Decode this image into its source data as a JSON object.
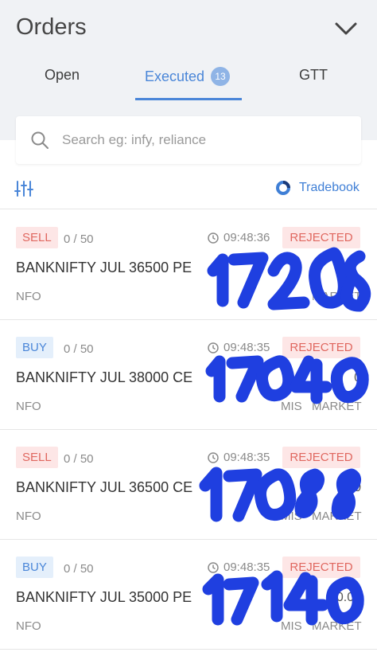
{
  "header": {
    "title": "Orders"
  },
  "tabs": {
    "open": "Open",
    "executed": "Executed",
    "executed_count": "13",
    "gtt": "GTT"
  },
  "search": {
    "placeholder": "Search eg: infy, reliance"
  },
  "toolbar": {
    "tradebook_label": "Tradebook"
  },
  "orders": [
    {
      "side": "SELL",
      "qty": "0  /  50",
      "time": "09:48:36",
      "status": "REJECTED",
      "symbol": "BANKNIFTY JUL 36500 PE",
      "price": "",
      "exchange": "NFO",
      "product": "",
      "order_type": "MARKET"
    },
    {
      "side": "BUY",
      "qty": "0  /  50",
      "time": "09:48:35",
      "status": "REJECTED",
      "symbol": "BANKNIFTY JUL 38000 CE",
      "price": "0",
      "exchange": "NFO",
      "product": "MIS",
      "order_type": "MARKET"
    },
    {
      "side": "SELL",
      "qty": "0  /  50",
      "time": "09:48:35",
      "status": "REJECTED",
      "symbol": "BANKNIFTY JUL 36500 CE",
      "price": "0",
      "exchange": "NFO",
      "product": "MIS",
      "order_type": "MARKET"
    },
    {
      "side": "BUY",
      "qty": "0  /  50",
      "time": "09:48:35",
      "status": "REJECTED",
      "symbol": "BANKNIFTY JUL 35000 PE",
      "price": "0.00",
      "exchange": "NFO",
      "product": "MIS",
      "order_type": "MARKET"
    }
  ],
  "handwritten_annotations": [
    "17208",
    "17040",
    "17088",
    "17140"
  ],
  "colors": {
    "accent": "#4a86d8",
    "rejected": "#e0675f",
    "ink": "#1f3fe0"
  }
}
